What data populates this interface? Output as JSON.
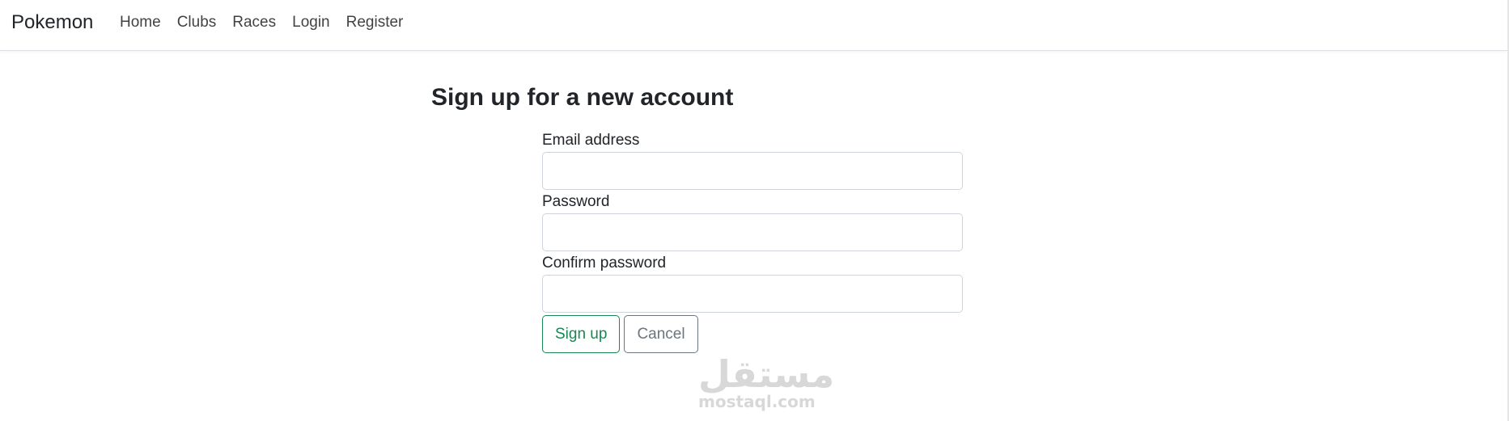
{
  "navbar": {
    "brand": "Pokemon",
    "links": [
      {
        "label": "Home"
      },
      {
        "label": "Clubs"
      },
      {
        "label": "Races"
      },
      {
        "label": "Login"
      },
      {
        "label": "Register"
      }
    ]
  },
  "page": {
    "title": "Sign up for a new account"
  },
  "form": {
    "email": {
      "label": "Email address",
      "value": "",
      "placeholder": ""
    },
    "password": {
      "label": "Password",
      "value": "",
      "placeholder": ""
    },
    "confirm_password": {
      "label": "Confirm password",
      "value": "",
      "placeholder": ""
    },
    "submit_label": "Sign up",
    "cancel_label": "Cancel"
  },
  "watermark": {
    "arabic": "مستقل",
    "latin": "mostaql.com"
  },
  "colors": {
    "success": "#198754",
    "secondary": "#6c757d",
    "text": "#212529",
    "border": "#ced4da"
  }
}
